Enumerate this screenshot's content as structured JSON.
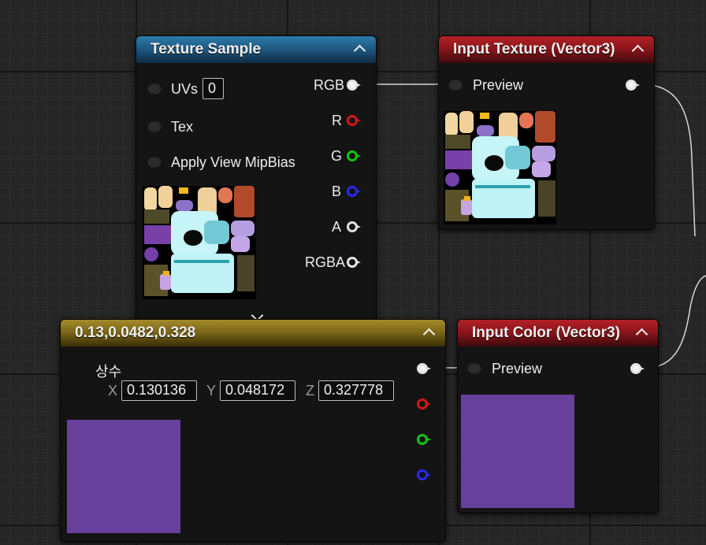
{
  "nodes": {
    "texture_sample": {
      "title": "Texture Sample",
      "inputs": {
        "uvs": "UVs",
        "uvs_value": "0",
        "tex": "Tex",
        "apply_mip_bias": "Apply View MipBias"
      },
      "outputs": {
        "rgb": "RGB",
        "r": "R",
        "g": "G",
        "b": "B",
        "a": "A",
        "rgba": "RGBA"
      }
    },
    "input_texture": {
      "title": "Input Texture (Vector3)",
      "preview_label": "Preview"
    },
    "constant3": {
      "title": "0.13,0.0482,0.328",
      "param_name": "상수",
      "x_label": "X",
      "x_value": "0.130136",
      "y_label": "Y",
      "y_value": "0.048172",
      "z_label": "Z",
      "z_value": "0.327778",
      "swatch_color": "#66409b"
    },
    "input_color": {
      "title": "Input Color (Vector3)",
      "preview_label": "Preview",
      "swatch_color": "#66409b"
    }
  },
  "icons": {
    "collapse": "chevron-up-icon",
    "expand": "chevron-down-icon"
  },
  "colors": {
    "header_blue": "#1f5a82",
    "header_red": "#8c161b",
    "header_gold": "#7c6818",
    "pin_red": "#d41717",
    "pin_green": "#13c313",
    "pin_blue": "#2a2af0"
  }
}
